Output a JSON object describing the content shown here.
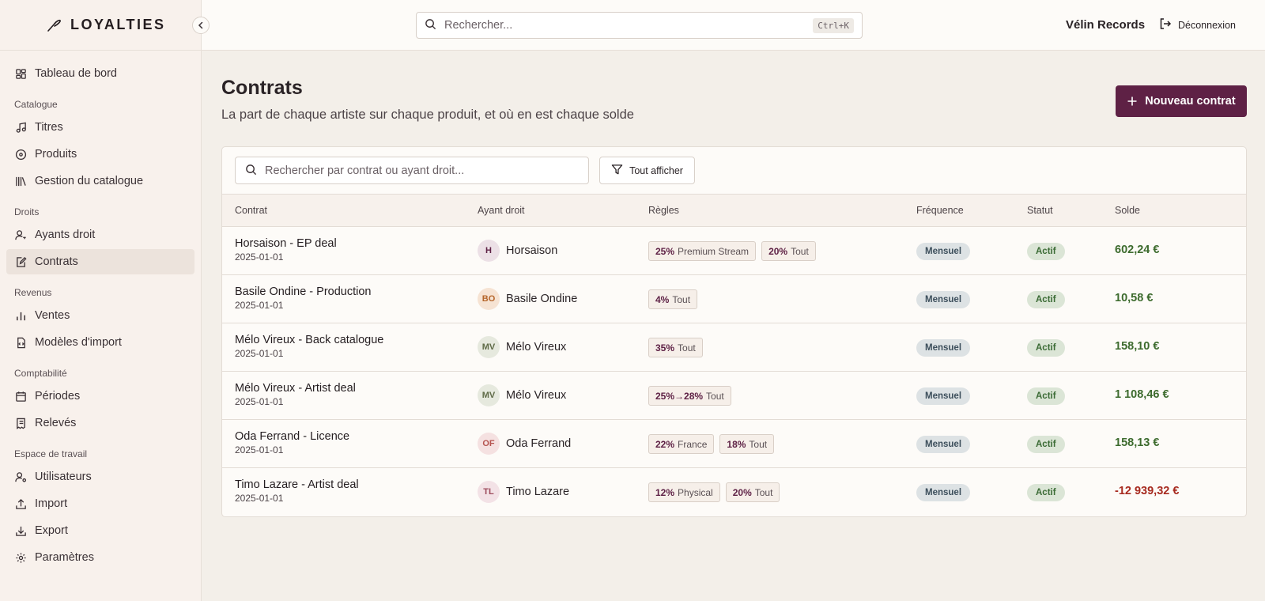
{
  "app": {
    "name": "LOYALTIES"
  },
  "topbar": {
    "search_placeholder": "Rechercher...",
    "shortcut": "Ctrl+K",
    "organization": "Vélin Records",
    "logout_label": "Déconnexion"
  },
  "sidebar": {
    "dashboard": "Tableau de bord",
    "sections": {
      "catalogue": "Catalogue",
      "droits": "Droits",
      "revenus": "Revenus",
      "comptabilite": "Comptabilité",
      "espace": "Espace de travail"
    },
    "items": {
      "titres": "Titres",
      "produits": "Produits",
      "gestion": "Gestion du catalogue",
      "ayants": "Ayants droit",
      "contrats": "Contrats",
      "ventes": "Ventes",
      "modeles": "Modèles d'import",
      "periodes": "Périodes",
      "releves": "Relevés",
      "utilisateurs": "Utilisateurs",
      "import": "Import",
      "export": "Export",
      "parametres": "Paramètres"
    },
    "active_item": "Contrats"
  },
  "page": {
    "title": "Contrats",
    "subtitle": "La part de chaque artiste sur chaque produit, et où en est chaque solde",
    "new_button": "Nouveau contrat"
  },
  "filters": {
    "search_placeholder": "Rechercher par contrat ou ayant droit...",
    "show_all": "Tout afficher"
  },
  "table": {
    "headers": {
      "contract": "Contrat",
      "holder": "Ayant droit",
      "rules": "Règles",
      "frequency": "Fréquence",
      "status": "Statut",
      "balance": "Solde"
    },
    "rows": [
      {
        "name": "Horsaison - EP deal",
        "date": "2025-01-01",
        "initials": "H",
        "holder": "Horsaison",
        "avatar_bg": "#ece0e6",
        "avatar_fg": "#5e2145",
        "rules": [
          {
            "pct": "25%",
            "scope": "Premium Stream"
          },
          {
            "pct": "20%",
            "scope": "Tout"
          }
        ],
        "frequency": "Mensuel",
        "status": "Actif",
        "balance": "602,24 €",
        "negative": false
      },
      {
        "name": "Basile Ondine - Production",
        "date": "2025-01-01",
        "initials": "BO",
        "holder": "Basile Ondine",
        "avatar_bg": "#f6e3d3",
        "avatar_fg": "#b5652a",
        "rules": [
          {
            "pct": "4%",
            "scope": "Tout"
          }
        ],
        "frequency": "Mensuel",
        "status": "Actif",
        "balance": "10,58 €",
        "negative": false
      },
      {
        "name": "Mélo Vireux - Back catalogue",
        "date": "2025-01-01",
        "initials": "MV",
        "holder": "Mélo Vireux",
        "avatar_bg": "#e6e9de",
        "avatar_fg": "#5f6b47",
        "rules": [
          {
            "pct": "35%",
            "scope": "Tout"
          }
        ],
        "frequency": "Mensuel",
        "status": "Actif",
        "balance": "158,10 €",
        "negative": false
      },
      {
        "name": "Mélo Vireux - Artist deal",
        "date": "2025-01-01",
        "initials": "MV",
        "holder": "Mélo Vireux",
        "avatar_bg": "#e6e9de",
        "avatar_fg": "#5f6b47",
        "rules": [
          {
            "pct": "25%→28%",
            "scope": "Tout"
          }
        ],
        "frequency": "Mensuel",
        "status": "Actif",
        "balance": "1 108,46 €",
        "negative": false
      },
      {
        "name": "Oda Ferrand - Licence",
        "date": "2025-01-01",
        "initials": "OF",
        "holder": "Oda Ferrand",
        "avatar_bg": "#f5e1e1",
        "avatar_fg": "#b5534f",
        "rules": [
          {
            "pct": "22%",
            "scope": "France"
          },
          {
            "pct": "18%",
            "scope": "Tout"
          }
        ],
        "frequency": "Mensuel",
        "status": "Actif",
        "balance": "158,13 €",
        "negative": false
      },
      {
        "name": "Timo Lazare - Artist deal",
        "date": "2025-01-01",
        "initials": "TL",
        "holder": "Timo Lazare",
        "avatar_bg": "#f3e2e6",
        "avatar_fg": "#9d4b5c",
        "rules": [
          {
            "pct": "12%",
            "scope": "Physical"
          },
          {
            "pct": "20%",
            "scope": "Tout"
          }
        ],
        "frequency": "Mensuel",
        "status": "Actif",
        "balance": "-12 939,32 €",
        "negative": true
      }
    ]
  }
}
